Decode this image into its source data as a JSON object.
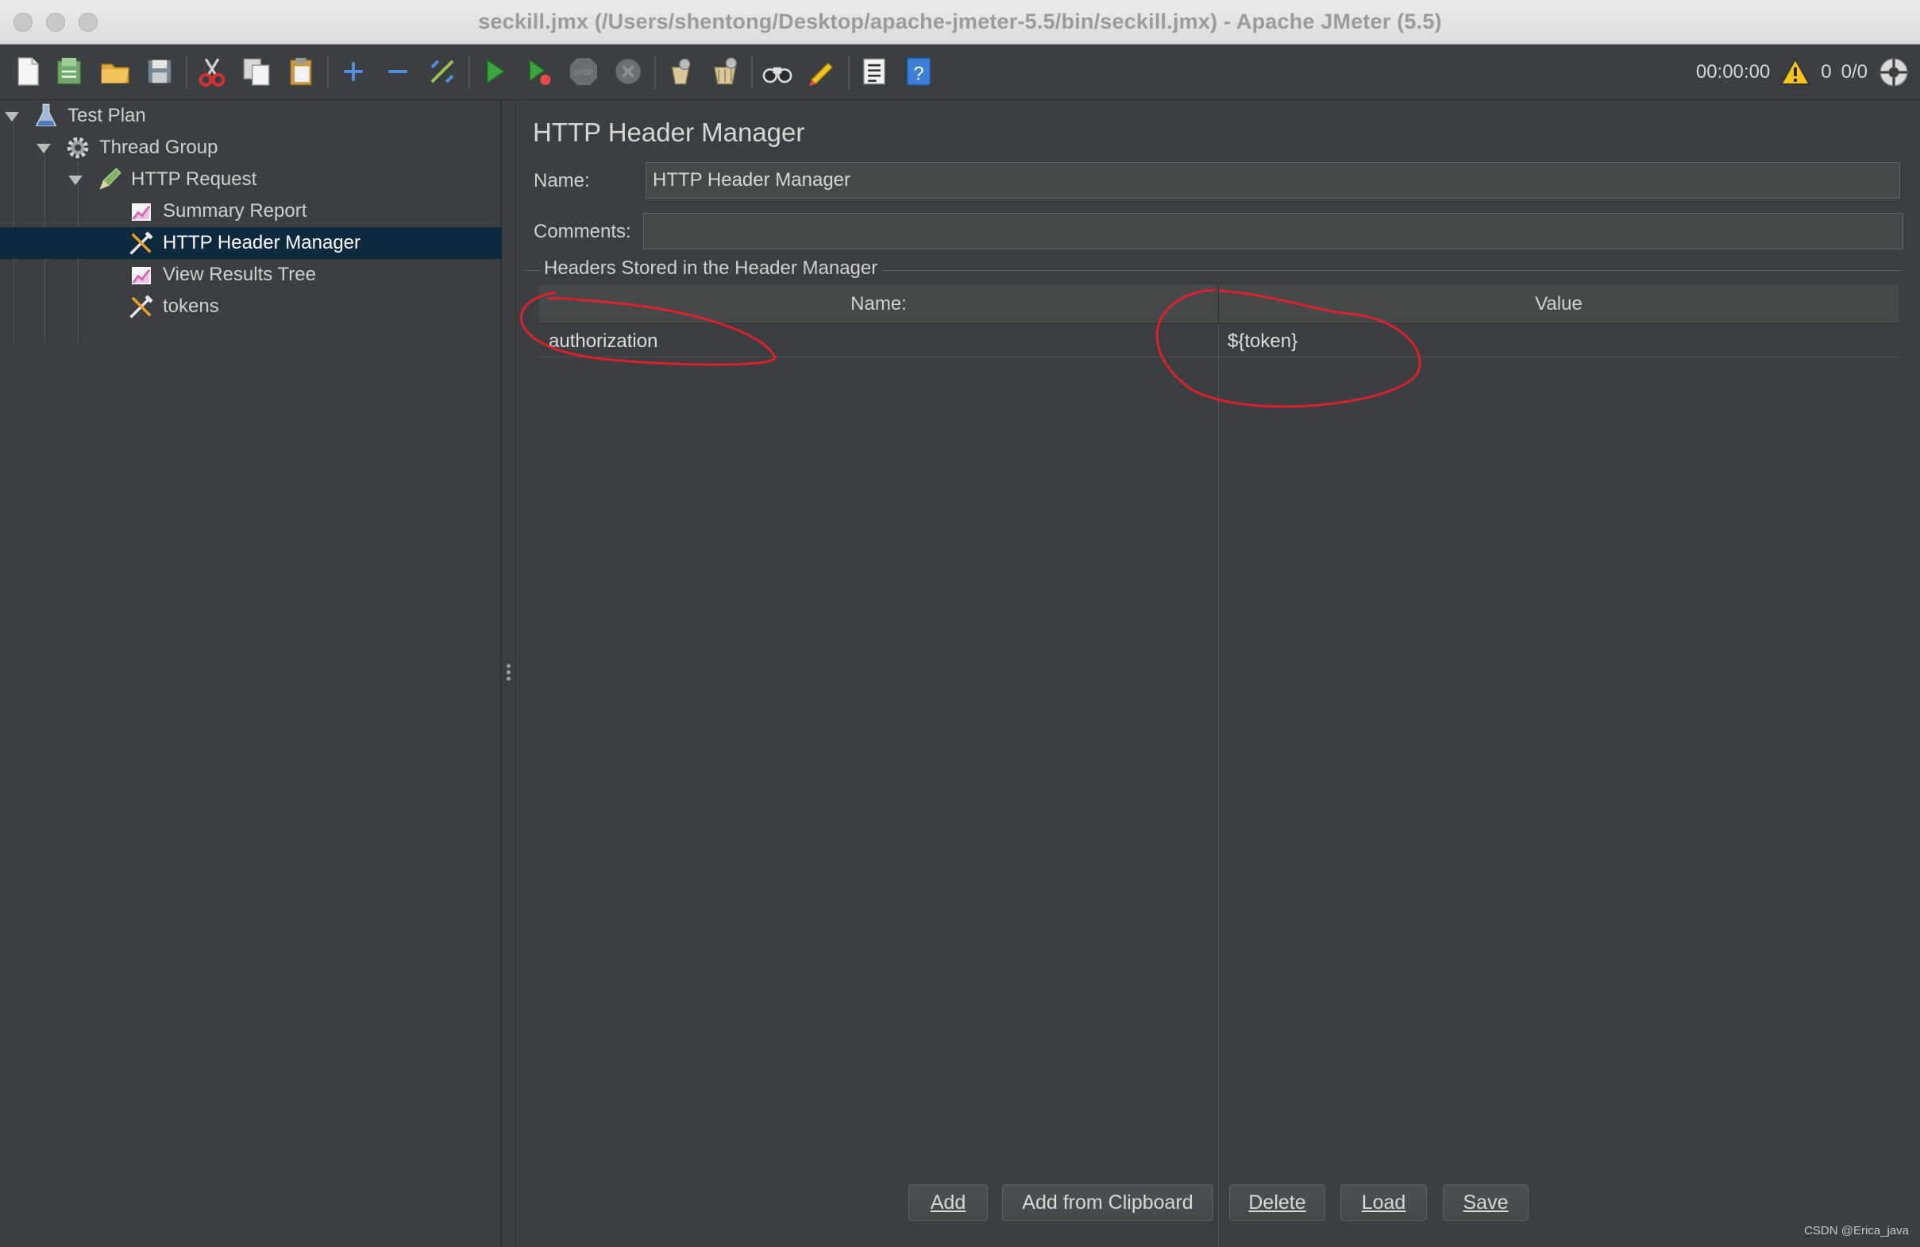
{
  "window": {
    "title": "seckill.jmx (/Users/shentong/Desktop/apache-jmeter-5.5/bin/seckill.jmx) - Apache JMeter (5.5)"
  },
  "toolbar": {
    "items": [
      "new",
      "templates",
      "open",
      "save",
      "cut",
      "copy",
      "paste",
      "expand",
      "collapse",
      "toggle",
      "start",
      "start-no-pauses",
      "stop",
      "shutdown",
      "clear",
      "clear-all",
      "search",
      "reset-search",
      "function-helper",
      "help"
    ],
    "elapsed_time": "00:00:00",
    "warning_count": "0",
    "threads": "0/0"
  },
  "tree": {
    "items": [
      {
        "label": "Test Plan",
        "icon": "flask-icon",
        "level": 0,
        "expanded": true
      },
      {
        "label": "Thread Group",
        "icon": "gear-icon",
        "level": 1,
        "expanded": true
      },
      {
        "label": "HTTP Request",
        "icon": "pen-icon",
        "level": 2,
        "expanded": true
      },
      {
        "label": "Summary Report",
        "icon": "chart-icon",
        "level": 3
      },
      {
        "label": "HTTP Header Manager",
        "icon": "tools-icon",
        "level": 3,
        "selected": true
      },
      {
        "label": "View Results Tree",
        "icon": "chart-icon",
        "level": 3
      },
      {
        "label": "tokens",
        "icon": "tools-icon",
        "level": 3
      }
    ]
  },
  "panel": {
    "title": "HTTP Header Manager",
    "name_label": "Name:",
    "name_value": "HTTP Header Manager",
    "comments_label": "Comments:",
    "comments_value": "",
    "group_title": "Headers Stored in the Header Manager",
    "table": {
      "columns": [
        "Name:",
        "Value"
      ],
      "rows": [
        {
          "name": "authorization",
          "value": "${token}"
        }
      ]
    },
    "buttons": {
      "add": "Add",
      "add_from_clipboard": "Add from Clipboard",
      "delete": "Delete",
      "load": "Load",
      "save": "Save"
    }
  },
  "annotation_color": "#e0202a",
  "colors": {
    "background": "#3c3f41",
    "selection": "#0d293e",
    "field": "#45494a"
  },
  "watermark": "CSDN @Erica_java"
}
